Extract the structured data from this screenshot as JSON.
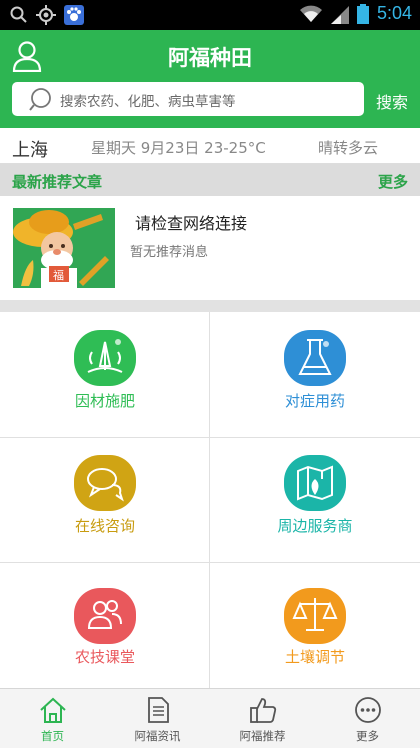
{
  "status": {
    "time": "5:04"
  },
  "header": {
    "title": "阿福种田",
    "search_placeholder": "搜索农药、化肥、病虫草害等",
    "search_button": "搜索"
  },
  "weather": {
    "city": "上海",
    "date": "星期天  9月23日  23-25°C",
    "condition": "晴转多云"
  },
  "section": {
    "title": "最新推荐文章",
    "more": "更多"
  },
  "article": {
    "title": "请检查网络连接",
    "subtitle": "暂无推荐消息",
    "badge": "福"
  },
  "grid": [
    {
      "label": "因材施肥",
      "icon": "fertilizer-icon",
      "color": "#2fbd55"
    },
    {
      "label": "对症用药",
      "icon": "flask-icon",
      "color": "#2e8fd6"
    },
    {
      "label": "在线咨询",
      "icon": "chat-icon",
      "color": "#d0a414"
    },
    {
      "label": "周边服务商",
      "icon": "map-icon",
      "color": "#1bb5a8"
    },
    {
      "label": "农技课堂",
      "icon": "people-icon",
      "color": "#e9585c"
    },
    {
      "label": "土壤调节",
      "icon": "scale-icon",
      "color": "#f29a1d"
    }
  ],
  "tabs": [
    {
      "label": "首页",
      "icon": "home-icon"
    },
    {
      "label": "阿福资讯",
      "icon": "news-icon"
    },
    {
      "label": "阿福推荐",
      "icon": "thumbs-up-icon"
    },
    {
      "label": "更多",
      "icon": "more-icon"
    }
  ]
}
